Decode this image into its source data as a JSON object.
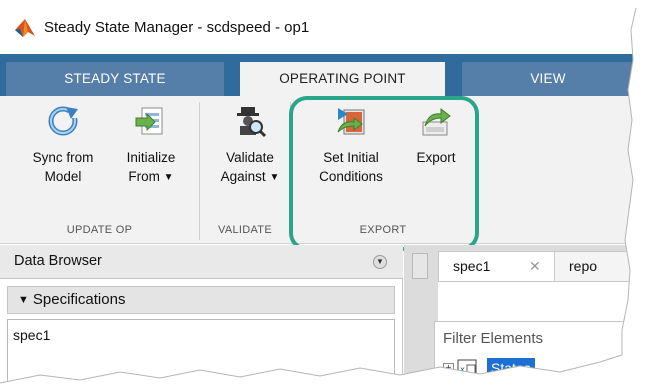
{
  "window": {
    "title": "Steady State Manager - scdspeed - op1",
    "logo_icon": "matlab-logo-icon"
  },
  "tabs": [
    {
      "label": "STEADY STATE",
      "selected": false
    },
    {
      "label": "OPERATING POINT",
      "selected": true
    },
    {
      "label": "VIEW",
      "selected": false
    }
  ],
  "toolstrip": {
    "sync": {
      "line1": "Sync from",
      "line2": "Model",
      "icon": "sync-icon"
    },
    "initialize": {
      "line1": "Initialize",
      "line2": "From",
      "icon": "initialize-icon"
    },
    "validate": {
      "line1": "Validate",
      "line2": "Against",
      "icon": "validate-icon"
    },
    "set_initial": {
      "line1": "Set Initial",
      "line2": "Conditions",
      "icon": "set-initial-conditions-icon"
    },
    "export": {
      "line1": "Export",
      "icon": "export-icon"
    },
    "dropdown_glyph": "▼",
    "groups": {
      "update_op": "UPDATE OP",
      "validate": "VALIDATE",
      "export": "EXPORT"
    },
    "highlight_color": "#2aa58a"
  },
  "data_browser": {
    "title": "Data Browser",
    "section": "Specifications",
    "items": [
      "spec1"
    ]
  },
  "document": {
    "tabs": [
      {
        "label": "spec1",
        "close": "✕"
      },
      {
        "label": "repo"
      }
    ],
    "filter_placeholder": "Filter Elements",
    "tree": {
      "expander": "⊞",
      "selected_node": "States"
    }
  },
  "colors": {
    "tabstrip": "#2f6c9d",
    "tab_inactive": "#557ea8",
    "toolstrip_bg": "#f2f2f2",
    "selection": "#1d6fd1"
  }
}
